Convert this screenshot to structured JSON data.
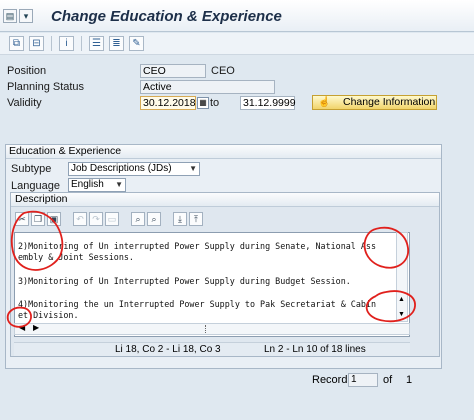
{
  "window": {
    "title": "Change Education & Experience"
  },
  "title_icons": [
    "document-icon",
    "dropdown-arrow-icon"
  ],
  "toolbar": {
    "buttons": [
      "copy-icon",
      "delimit-icon",
      "info-icon",
      "overview-icon",
      "list-icon",
      "edit-icon"
    ]
  },
  "header": {
    "position_label": "Position",
    "position_value": "CEO",
    "position_text": "CEO",
    "planning_status_label": "Planning Status",
    "planning_status_value": "Active",
    "validity_label": "Validity",
    "validity_from": "30.12.2018",
    "validity_to_label": "to",
    "validity_to": "31.12.9999",
    "change_info_button": "Change Information"
  },
  "group": {
    "title": "Education & Experience",
    "subtype_label": "Subtype",
    "subtype_value": "Job Descriptions (JDs)",
    "language_label": "Language",
    "language_value": "English"
  },
  "description": {
    "title": "Description",
    "lines": [
      "2)Monitoring of Un interrupted Power Supply during Senate, National Ass",
      "embly & Joint Sessions.",
      "3)Monitoring of Un Interrupted Power Supply during Budget Session.",
      "4)Monitoring the un Interrupted Power Supply to Pak Secretariat & Cabin",
      "et Division."
    ],
    "cursor_pos": "Li 18, Co 2 - Li 18, Co 3",
    "line_info": "Ln 2 - Ln 10 of 18 lines"
  },
  "record": {
    "label": "Record",
    "current": "1",
    "of_label": "of",
    "total": "1"
  },
  "colors": {
    "annotation_red": "#e0201c",
    "accent_yellow": "#f1d46a"
  }
}
